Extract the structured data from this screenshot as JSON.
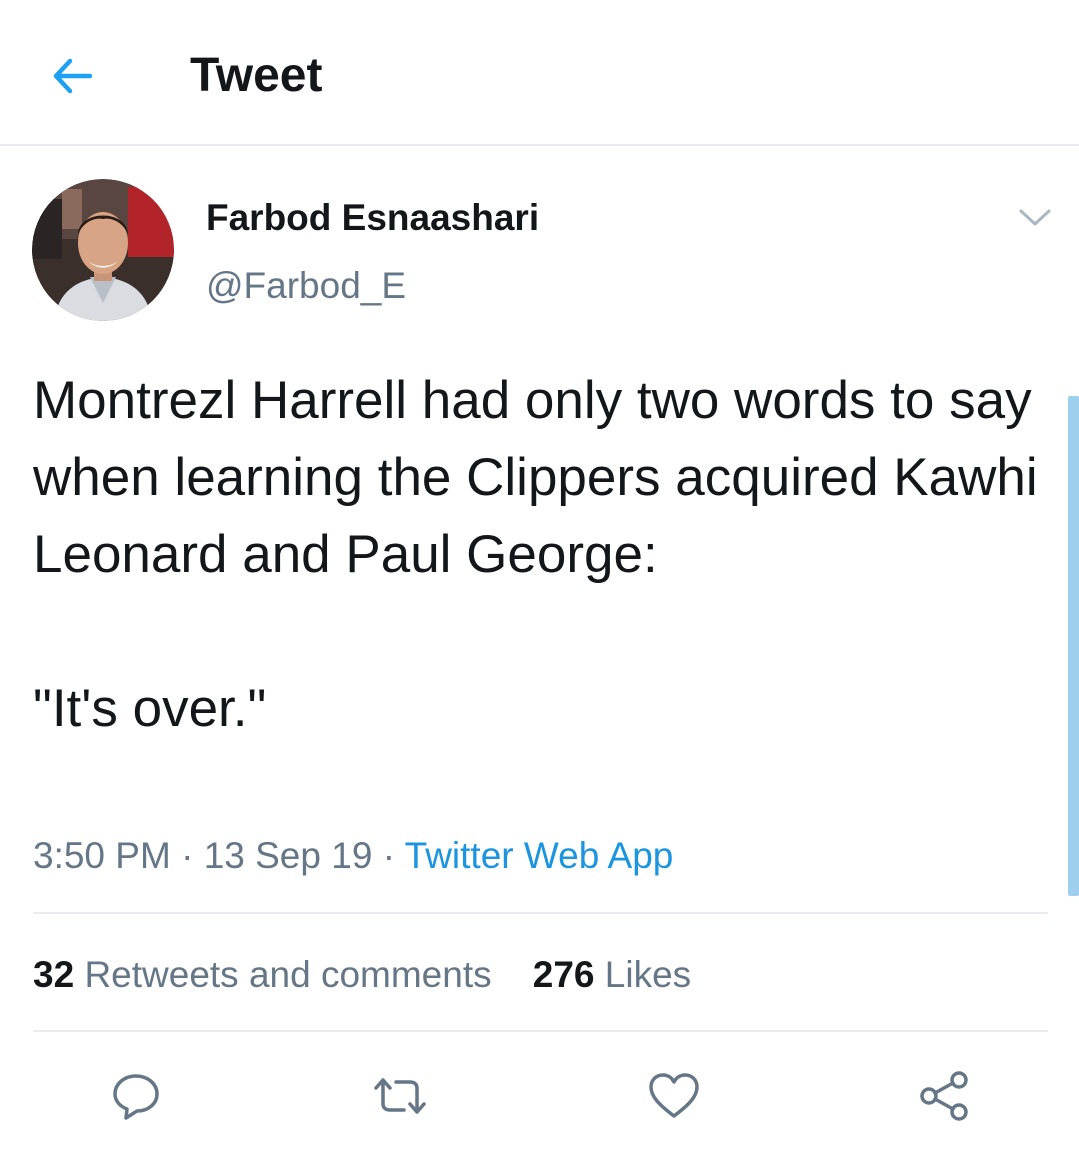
{
  "header": {
    "title": "Tweet",
    "back_icon": "arrow-left-icon"
  },
  "colors": {
    "accent": "#1da1f2",
    "link": "#1b95e0",
    "secondary_text": "#657786",
    "primary_text": "#14171a",
    "divider": "#e6ecf0"
  },
  "tweet": {
    "author_name": "Farbod Esnaashari",
    "author_handle": "@Farbod_E",
    "text": "Montrezl Harrell had only two words to say when learning the Clippers acquired Kawhi Leonard and Paul George:\n\n\"It's over.\"",
    "time": "3:50 PM",
    "separator": "·",
    "date": "13 Sep 19",
    "source": "Twitter Web App"
  },
  "stats": {
    "retweets_count": "32",
    "retweets_label": "Retweets and comments",
    "likes_count": "276",
    "likes_label": "Likes"
  },
  "actions": {
    "reply_icon": "reply-icon",
    "retweet_icon": "retweet-icon",
    "like_icon": "heart-icon",
    "share_icon": "share-icon"
  }
}
